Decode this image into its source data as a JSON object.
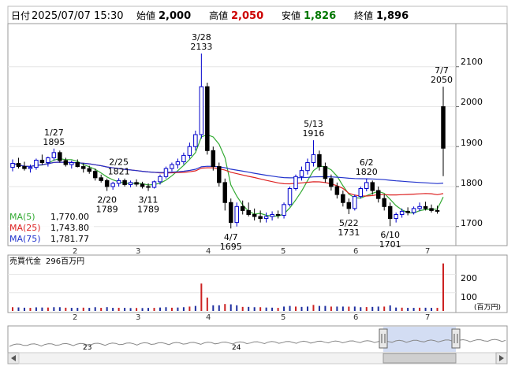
{
  "header": {
    "date_label": "日付",
    "datetime": "2025/07/07 15:30",
    "open_label": "始値",
    "open": "2,000",
    "high_label": "高値",
    "high": "2,050",
    "low_label": "安値",
    "low": "1,826",
    "close_label": "終値",
    "close": "1,896"
  },
  "colors": {
    "up": "#0000cc",
    "down": "#000000",
    "ma5": "#33aa33",
    "ma25": "#dd2222",
    "ma75": "#2233cc",
    "vol_up": "#1f2f9f",
    "vol_down": "#cc2222",
    "high_text": "#cc0000",
    "low_text": "#007700"
  },
  "chart_data": {
    "type": "candlestick",
    "y_ticks": [
      "2100",
      "2000",
      "1900",
      "1800",
      "1700"
    ],
    "ylim": [
      1660,
      2200
    ],
    "x_ticks": [
      "2",
      "3",
      "4",
      "5",
      "6",
      "7"
    ],
    "annotations": [
      {
        "date": "1/27",
        "price": "1895"
      },
      {
        "date": "2/25",
        "price": "1821"
      },
      {
        "date": "2/20",
        "price": "1789"
      },
      {
        "date": "3/11",
        "price": "1789"
      },
      {
        "date": "3/28",
        "price": "2133"
      },
      {
        "date": "4/7",
        "price": "1695"
      },
      {
        "date": "5/13",
        "price": "1916"
      },
      {
        "date": "5/22",
        "price": "1731"
      },
      {
        "date": "6/2",
        "price": "1820"
      },
      {
        "date": "6/10",
        "price": "1701"
      },
      {
        "date": "7/7",
        "price": "2050"
      }
    ],
    "legend": [
      {
        "name": "MA(5)",
        "value": "1,770.00"
      },
      {
        "name": "MA(25)",
        "value": "1,743.80"
      },
      {
        "name": "MA(75)",
        "value": "1,781.77"
      }
    ],
    "candles": [
      [
        1848,
        1868,
        1838,
        1858
      ],
      [
        1858,
        1872,
        1845,
        1850
      ],
      [
        1850,
        1862,
        1840,
        1845
      ],
      [
        1845,
        1855,
        1835,
        1848
      ],
      [
        1848,
        1870,
        1842,
        1866
      ],
      [
        1866,
        1880,
        1855,
        1860
      ],
      [
        1860,
        1875,
        1850,
        1872
      ],
      [
        1872,
        1895,
        1865,
        1885
      ],
      [
        1885,
        1890,
        1860,
        1865
      ],
      [
        1865,
        1872,
        1850,
        1855
      ],
      [
        1855,
        1865,
        1845,
        1860
      ],
      [
        1860,
        1868,
        1848,
        1850
      ],
      [
        1850,
        1858,
        1835,
        1845
      ],
      [
        1845,
        1852,
        1832,
        1838
      ],
      [
        1838,
        1845,
        1815,
        1822
      ],
      [
        1822,
        1830,
        1810,
        1815
      ],
      [
        1815,
        1820,
        1789,
        1800
      ],
      [
        1800,
        1812,
        1792,
        1808
      ],
      [
        1808,
        1821,
        1800,
        1815
      ],
      [
        1815,
        1820,
        1800,
        1805
      ],
      [
        1805,
        1815,
        1798,
        1810
      ],
      [
        1810,
        1818,
        1800,
        1806
      ],
      [
        1806,
        1812,
        1795,
        1800
      ],
      [
        1800,
        1808,
        1789,
        1798
      ],
      [
        1798,
        1815,
        1795,
        1812
      ],
      [
        1812,
        1830,
        1805,
        1825
      ],
      [
        1825,
        1850,
        1820,
        1845
      ],
      [
        1845,
        1860,
        1838,
        1855
      ],
      [
        1855,
        1870,
        1845,
        1862
      ],
      [
        1862,
        1885,
        1855,
        1878
      ],
      [
        1878,
        1910,
        1870,
        1900
      ],
      [
        1900,
        1940,
        1890,
        1930
      ],
      [
        1930,
        2133,
        1920,
        2050
      ],
      [
        2050,
        2060,
        1880,
        1890
      ],
      [
        1890,
        1900,
        1840,
        1850
      ],
      [
        1850,
        1860,
        1800,
        1810
      ],
      [
        1810,
        1820,
        1740,
        1760
      ],
      [
        1760,
        1770,
        1695,
        1710
      ],
      [
        1710,
        1760,
        1700,
        1750
      ],
      [
        1750,
        1765,
        1730,
        1740
      ],
      [
        1740,
        1760,
        1725,
        1730
      ],
      [
        1730,
        1745,
        1715,
        1725
      ],
      [
        1725,
        1740,
        1710,
        1720
      ],
      [
        1720,
        1735,
        1710,
        1725
      ],
      [
        1725,
        1738,
        1715,
        1730
      ],
      [
        1730,
        1740,
        1720,
        1728
      ],
      [
        1728,
        1760,
        1720,
        1755
      ],
      [
        1755,
        1800,
        1750,
        1795
      ],
      [
        1795,
        1830,
        1790,
        1825
      ],
      [
        1825,
        1850,
        1815,
        1840
      ],
      [
        1840,
        1870,
        1830,
        1860
      ],
      [
        1860,
        1916,
        1850,
        1880
      ],
      [
        1880,
        1890,
        1840,
        1850
      ],
      [
        1850,
        1860,
        1810,
        1820
      ],
      [
        1820,
        1830,
        1790,
        1800
      ],
      [
        1800,
        1810,
        1770,
        1780
      ],
      [
        1780,
        1790,
        1750,
        1760
      ],
      [
        1760,
        1770,
        1731,
        1745
      ],
      [
        1745,
        1780,
        1740,
        1775
      ],
      [
        1775,
        1800,
        1770,
        1795
      ],
      [
        1795,
        1820,
        1788,
        1810
      ],
      [
        1810,
        1815,
        1780,
        1790
      ],
      [
        1790,
        1800,
        1760,
        1770
      ],
      [
        1770,
        1780,
        1740,
        1750
      ],
      [
        1750,
        1760,
        1701,
        1720
      ],
      [
        1720,
        1735,
        1710,
        1730
      ],
      [
        1730,
        1745,
        1722,
        1738
      ],
      [
        1738,
        1748,
        1728,
        1735
      ],
      [
        1735,
        1750,
        1730,
        1745
      ],
      [
        1745,
        1760,
        1738,
        1750
      ],
      [
        1750,
        1762,
        1740,
        1745
      ],
      [
        1745,
        1755,
        1735,
        1740
      ],
      [
        1740,
        1752,
        1732,
        1738
      ],
      [
        2000,
        2050,
        1826,
        1896
      ]
    ],
    "volume_unit": "(百万円)",
    "volume_label": "売買代金",
    "volume_latest": "296百万円",
    "volume_ticks": [
      "200",
      "100"
    ],
    "navigator_labels": [
      "23",
      "24"
    ]
  }
}
